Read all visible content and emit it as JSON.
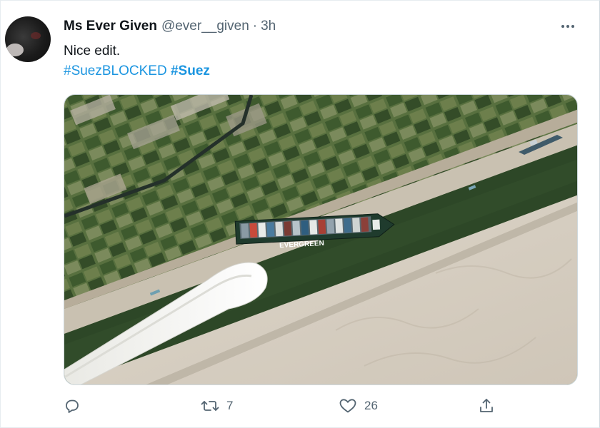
{
  "tweet": {
    "author": {
      "display_name": "Ms Ever Given",
      "handle": "@ever__given",
      "separator": "·",
      "time": "3h"
    },
    "text": "Nice edit.",
    "hashtags": [
      {
        "label": "#SuezBLOCKED",
        "bold": false
      },
      {
        "label": "#Suez",
        "bold": true
      }
    ],
    "media": {
      "ship_label": "EVERGREEN"
    },
    "actions": {
      "reply": {
        "icon": "reply-icon",
        "count": ""
      },
      "retweet": {
        "icon": "retweet-icon",
        "count": "7"
      },
      "like": {
        "icon": "heart-icon",
        "count": "26"
      },
      "share": {
        "icon": "share-icon",
        "count": ""
      }
    }
  },
  "colors": {
    "link": "#1b95e0",
    "text": "#0f1419",
    "secondary": "#536471",
    "canal_water": "#2e4a2a",
    "desert": "#d8d0c3",
    "farmland": "#4f6b3a"
  }
}
